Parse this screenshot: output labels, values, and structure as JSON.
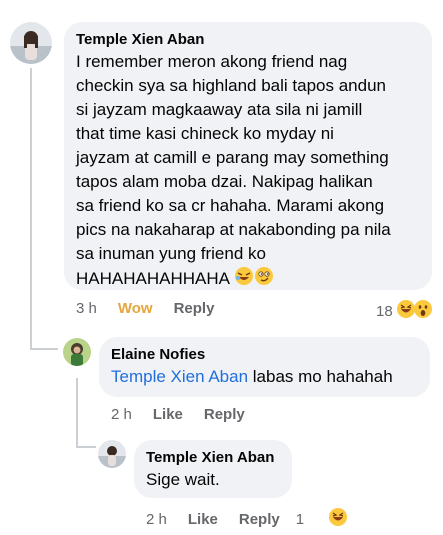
{
  "comments": {
    "main": {
      "author": "Temple Xien Aban",
      "text_lines": [
        "I remember meron akong friend nag",
        "checkin sya sa highland bali tapos andun",
        "si jayzam magkaaway ata sila ni jamill",
        "that time kasi chineck ko myday ni",
        "jayzam at camill e parang may something",
        "tapos alam moba dzai. Nakipag halikan",
        "sa friend ko sa cr hahaha. Marami akong",
        "pics na nakaharap at nakabonding pa nila",
        "sa inuman yung friend ko",
        "HAHAHAHAHHAHA"
      ],
      "time": "3 h",
      "reaction_label": "Wow",
      "reply_label": "Reply",
      "reaction_count": "18",
      "reaction_icons": [
        "laughing-emoji-icon",
        "wow-emoji-icon"
      ]
    },
    "reply1": {
      "author": "Elaine Nofies",
      "mention": "Temple Xien Aban",
      "text": " labas mo hahahah",
      "time": "2 h",
      "like_label": "Like",
      "reply_label": "Reply"
    },
    "reply2": {
      "author": "Temple Xien Aban",
      "text": "Sige wait.",
      "time": "2 h",
      "like_label": "Like",
      "reply_label": "Reply",
      "reaction_count": "1",
      "reaction_icons": [
        "laughing-emoji-icon"
      ]
    }
  },
  "colors": {
    "bubble": "#f0f2f5",
    "mention": "#216fdb",
    "wow": "#e5a53a",
    "meta": "#65676b"
  }
}
